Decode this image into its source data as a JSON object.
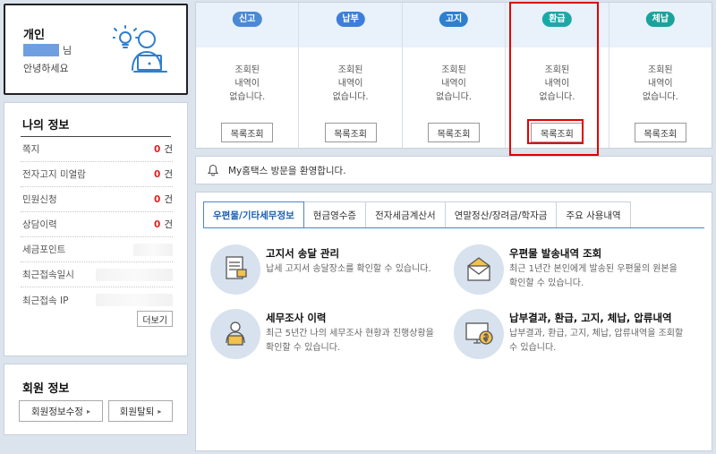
{
  "user": {
    "type": "개인",
    "name_suffix": "님",
    "greeting": "안녕하세요"
  },
  "my_info": {
    "title": "나의 정보",
    "rows": [
      {
        "label": "쪽지",
        "count": "0",
        "unit": "건"
      },
      {
        "label": "전자고지 미열람",
        "count": "0",
        "unit": "건"
      },
      {
        "label": "민원신청",
        "count": "0",
        "unit": "건"
      },
      {
        "label": "상담이력",
        "count": "0",
        "unit": "건"
      },
      {
        "label": "세금포인트"
      },
      {
        "label": "최근접속일시"
      },
      {
        "label": "최근접속 IP"
      }
    ],
    "more_label": "더보기"
  },
  "member": {
    "title": "회원 정보",
    "edit_label": "회원정보수정",
    "withdraw_label": "회원탈퇴"
  },
  "status_cards": [
    {
      "tag": "신고",
      "color": "#4a8ad4",
      "empty_text": "조회된\n내역이\n없습니다.",
      "button": "목록조회"
    },
    {
      "tag": "납부",
      "color": "#3d7fd8",
      "empty_text": "조회된\n내역이\n없습니다.",
      "button": "목록조회"
    },
    {
      "tag": "고지",
      "color": "#2f7fcf",
      "empty_text": "조회된\n내역이\n없습니다.",
      "button": "목록조회"
    },
    {
      "tag": "환급",
      "color": "#1da8a8",
      "empty_text": "조회된\n내역이\n없습니다.",
      "button": "목록조회"
    },
    {
      "tag": "체납",
      "color": "#1aa39a",
      "empty_text": "조회된\n내역이\n없습니다.",
      "button": "목록조회"
    }
  ],
  "notice": {
    "text": "My홈택스 방문을 환영합니다."
  },
  "tabs": [
    {
      "label": "우편물/기타세무정보",
      "active": true
    },
    {
      "label": "현금영수증"
    },
    {
      "label": "전자세금계산서"
    },
    {
      "label": "연말정산/장려금/학자금"
    },
    {
      "label": "주요 사용내역"
    }
  ],
  "services": [
    {
      "title": "고지서 송달 관리",
      "desc": "납세 고지서 송달장소를 확인할 수 있습니다.",
      "icon": "document-icon"
    },
    {
      "title": "우편물 발송내역 조회",
      "desc": "최근 1년간 본인에게 발송된 우편물의 원본을 확인할 수 있습니다.",
      "icon": "envelope-icon"
    },
    {
      "title": "세무조사 이력",
      "desc": "최근 5년간 나의 세무조사 현황과 진행상황을 확인할 수 있습니다.",
      "icon": "person-laptop-icon"
    },
    {
      "title": "납부결과, 환급, 고지, 체납, 압류내역",
      "desc": "납부결과, 환급, 고지, 체납, 압류내역을 조회할 수 있습니다.",
      "icon": "monitor-coin-icon"
    }
  ]
}
